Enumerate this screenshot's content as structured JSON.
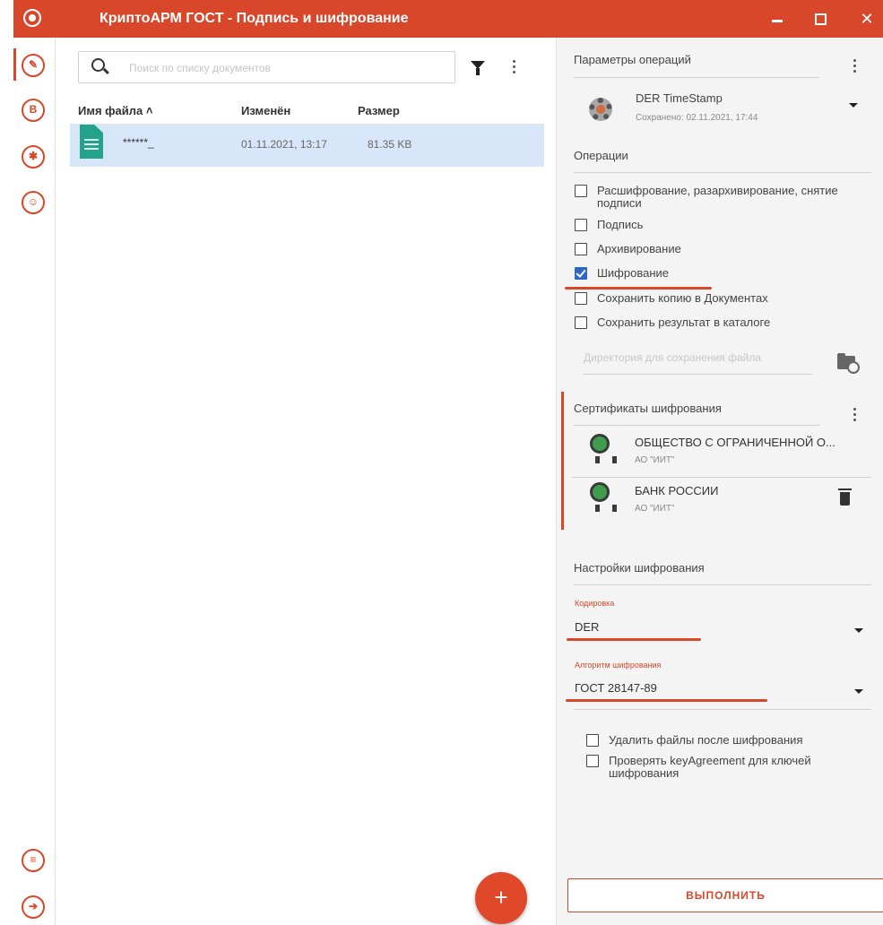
{
  "window": {
    "title": "КриптоАРМ ГОСТ - Подпись и шифрование",
    "minimize": "—",
    "maximize": "",
    "close": "✕"
  },
  "rail": {
    "items": [
      {
        "icon": "sign-encrypt-icon",
        "active": true
      },
      {
        "icon": "documents-icon"
      },
      {
        "icon": "certificates-icon"
      },
      {
        "icon": "contacts-icon"
      },
      {
        "icon": "events-icon"
      },
      {
        "icon": "exit-icon"
      }
    ]
  },
  "file_list": {
    "search_placeholder": "Поиск по списку документов",
    "columns": [
      "Имя файла ˄",
      "Изменён",
      "Размер"
    ],
    "files": [
      {
        "name": "******_",
        "modified": "01.11.2021, 13:17",
        "size": "81.35 KB"
      }
    ],
    "fab_label": "+"
  },
  "settings": {
    "params_title": "Параметры операций",
    "preset": {
      "name": "DER TimeStamp",
      "saved": "Сохранено: 02.11.2021, 17:44"
    },
    "operations_title": "Операции",
    "operations": [
      {
        "label": "Расшифрование, разархивирование, снятие подписи",
        "checked": false
      },
      {
        "label": "Подпись",
        "checked": false
      },
      {
        "label": "Архивирование",
        "checked": false
      },
      {
        "label": "Шифрование",
        "checked": true
      },
      {
        "label": "Сохранить копию в Документах",
        "checked": false
      },
      {
        "label": "Сохранить результат в каталоге",
        "checked": false
      }
    ],
    "directory_placeholder": "Директория для сохранения файла",
    "certs_title": "Сертификаты шифрования",
    "certs": [
      {
        "title": "ОБЩЕСТВО С ОГРАНИЧЕННОЙ О...",
        "issuer": "АО \"ИИТ\""
      },
      {
        "title": "БАНК РОССИИ",
        "issuer": "АО \"ИИТ\""
      }
    ],
    "encryption_title": "Настройки шифрования",
    "encoding": {
      "label": "Кодировка",
      "value": "DER"
    },
    "algorithm": {
      "label": "Алгоритм шифрования",
      "value": "ГОСТ 28147-89"
    },
    "extra_options": [
      {
        "label": "Удалить файлы после шифрования",
        "checked": false
      },
      {
        "label": "Проверять keyAgreement для ключей шифрования",
        "checked": false
      }
    ],
    "run_label": "ВЫПОЛНИТЬ"
  },
  "colors": {
    "accent": "#d9472b",
    "selected_row": "#d8e6fa",
    "checkbox_checked": "#2f68c4"
  }
}
